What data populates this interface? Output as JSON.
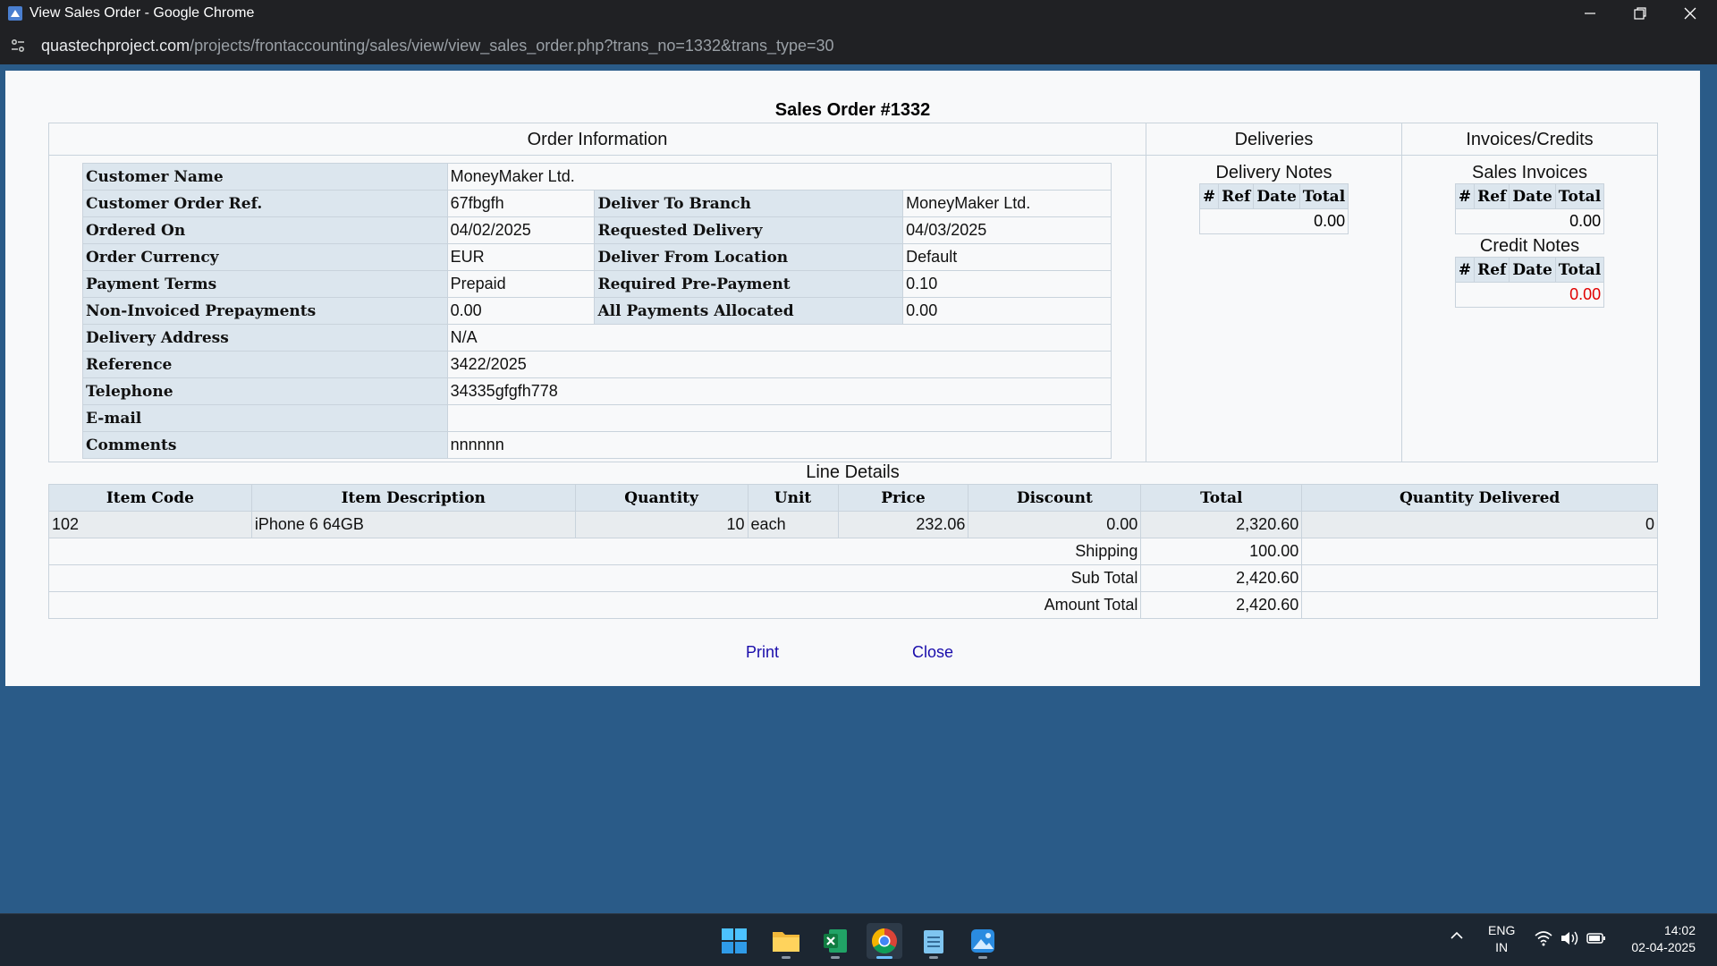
{
  "window": {
    "title": "View Sales Order - Google Chrome",
    "url_host": "quastechproject.com",
    "url_path": "/projects/frontaccounting/sales/view/view_sales_order.php?trans_no=1332&trans_type=30"
  },
  "page": {
    "title": "Sales Order #1332",
    "order_info_heading": "Order Information",
    "deliveries_heading": "Deliveries",
    "invoices_heading": "Invoices/Credits"
  },
  "order_info": {
    "customer_name_label": "Customer Name",
    "customer_name": "MoneyMaker Ltd.",
    "customer_ref_label": "Customer Order Ref.",
    "customer_ref": "67fbgfh",
    "deliver_to_branch_label": "Deliver To Branch",
    "deliver_to_branch": "MoneyMaker Ltd.",
    "ordered_on_label": "Ordered On",
    "ordered_on": "04/02/2025",
    "requested_delivery_label": "Requested Delivery",
    "requested_delivery": "04/03/2025",
    "order_currency_label": "Order Currency",
    "order_currency": "EUR",
    "deliver_from_label": "Deliver From Location",
    "deliver_from": "Default",
    "payment_terms_label": "Payment Terms",
    "payment_terms": "Prepaid",
    "required_prepayment_label": "Required Pre-Payment",
    "required_prepayment": "0.10",
    "non_invoiced_label": "Non-Invoiced Prepayments",
    "non_invoiced": "0.00",
    "all_payments_label": "All Payments Allocated",
    "all_payments": "0.00",
    "delivery_address_label": "Delivery Address",
    "delivery_address": "N/A",
    "reference_label": "Reference",
    "reference": "3422/2025",
    "telephone_label": "Telephone",
    "telephone": "34335gfgfh778",
    "email_label": "E-mail",
    "email": "",
    "comments_label": "Comments",
    "comments": "nnnnnn"
  },
  "deliveries": {
    "title": "Delivery Notes",
    "headers": [
      "#",
      "Ref",
      "Date",
      "Total"
    ],
    "total": "0.00"
  },
  "invoices": {
    "sales_title": "Sales Invoices",
    "headers": [
      "#",
      "Ref",
      "Date",
      "Total"
    ],
    "sales_total": "0.00",
    "credit_title": "Credit Notes",
    "credit_total": "0.00",
    "credit_total_color": "#e00000"
  },
  "line_details": {
    "title": "Line Details",
    "headers": [
      "Item Code",
      "Item Description",
      "Quantity",
      "Unit",
      "Price",
      "Discount",
      "Total",
      "Quantity Delivered"
    ],
    "rows": [
      {
        "code": "102",
        "description": "iPhone 6 64GB",
        "quantity": "10",
        "unit": "each",
        "price": "232.06",
        "discount": "0.00",
        "total": "2,320.60",
        "delivered": "0"
      }
    ],
    "shipping_label": "Shipping",
    "shipping": "100.00",
    "subtotal_label": "Sub Total",
    "subtotal": "2,420.60",
    "amount_total_label": "Amount Total",
    "amount_total": "2,420.60"
  },
  "actions": {
    "print": "Print",
    "close": "Close"
  },
  "taskbar": {
    "lang_line1": "ENG",
    "lang_line2": "IN",
    "time": "14:02",
    "date": "02-04-2025"
  }
}
